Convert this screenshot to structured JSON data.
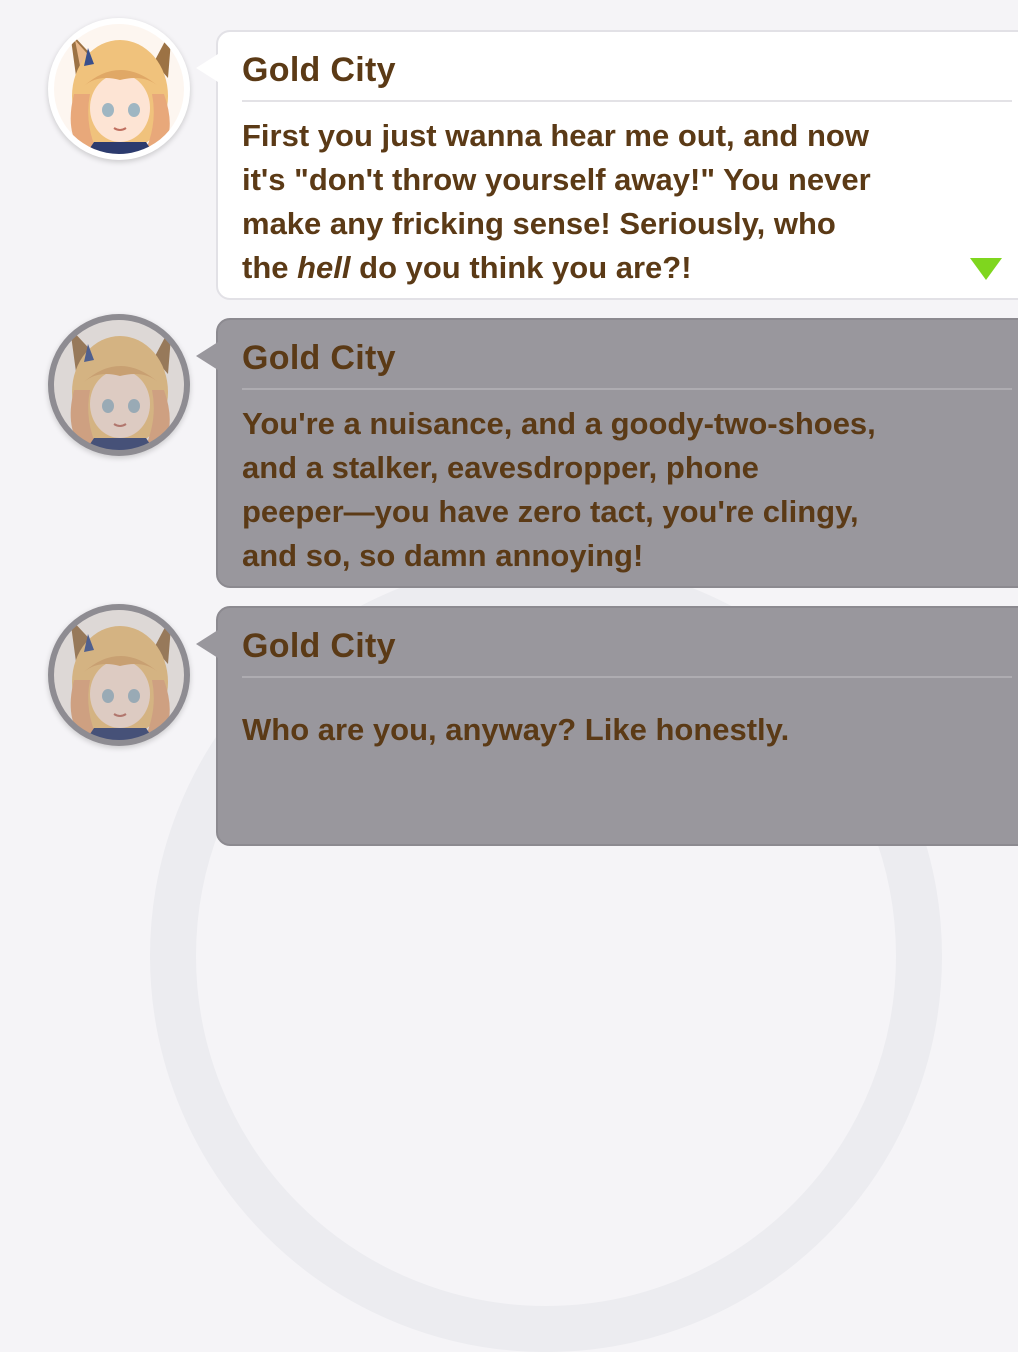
{
  "dialogue": [
    {
      "speaker": "Gold City",
      "lines": [
        "First you just wanna hear me out, and now",
        "it's \"don't throw yourself away!\" You never",
        "make any fricking sense! Seriously, who"
      ],
      "last_line": {
        "before": "the ",
        "emphasis": "hell",
        "after": " do you think you are?!"
      },
      "state": "current"
    },
    {
      "speaker": "Gold City",
      "lines": [
        "You're a nuisance, and a goody-two-shoes,",
        "and a stalker, eavesdropper, phone",
        "peeper—you have zero tact, you're clingy,",
        "and so, so damn annoying!"
      ],
      "state": "past"
    },
    {
      "speaker": "Gold City",
      "lines": [
        "Who are you, anyway? Like honestly."
      ],
      "state": "past"
    }
  ],
  "colors": {
    "text": "#5b3a16",
    "active_bubble": "#ffffff",
    "past_bubble": "#99979d",
    "next_arrow": "#7fd61e"
  },
  "icons": {
    "next": "next-arrow-icon"
  }
}
